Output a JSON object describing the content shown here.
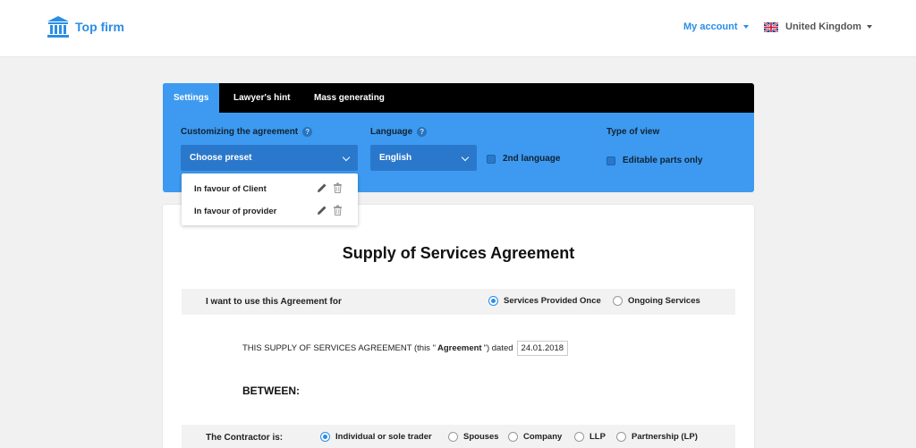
{
  "header": {
    "logo_text": "Top firm",
    "account_label": "My account",
    "country_label": "United Kingdom"
  },
  "tabs": [
    "Settings",
    "Lawyer's hint",
    "Mass generating"
  ],
  "settings": {
    "customizing_label": "Customizing the agreement",
    "language_label": "Language",
    "type_of_view_label": "Type of view",
    "preset_value": "Choose preset",
    "language_value": "English",
    "second_language_label": "2nd language",
    "editable_parts_label": "Editable parts only",
    "help_glyph": "?"
  },
  "presets": [
    "In favour of Client",
    "In favour of provider"
  ],
  "document": {
    "title": "Supply of Services Agreement",
    "use_for_label": "I want to use this Agreement for",
    "use_for_options": [
      "Services Provided Once",
      "Ongoing Services"
    ],
    "intro_prefix": "THIS SUPPLY OF SERVICES AGREEMENT (this \"",
    "intro_bold": "Agreement",
    "intro_suffix": "\") dated",
    "date_value": "24.01.2018",
    "between_label": "BETWEEN:",
    "contractor_label": "The Contractor is:",
    "contractor_options": [
      "Individual or sole trader",
      "Spouses",
      "Company",
      "LLP",
      "Partnership (LP)"
    ]
  },
  "colors": {
    "accent": "#2a8ee8",
    "panel": "#3d9af0",
    "tabbar": "#000000"
  }
}
